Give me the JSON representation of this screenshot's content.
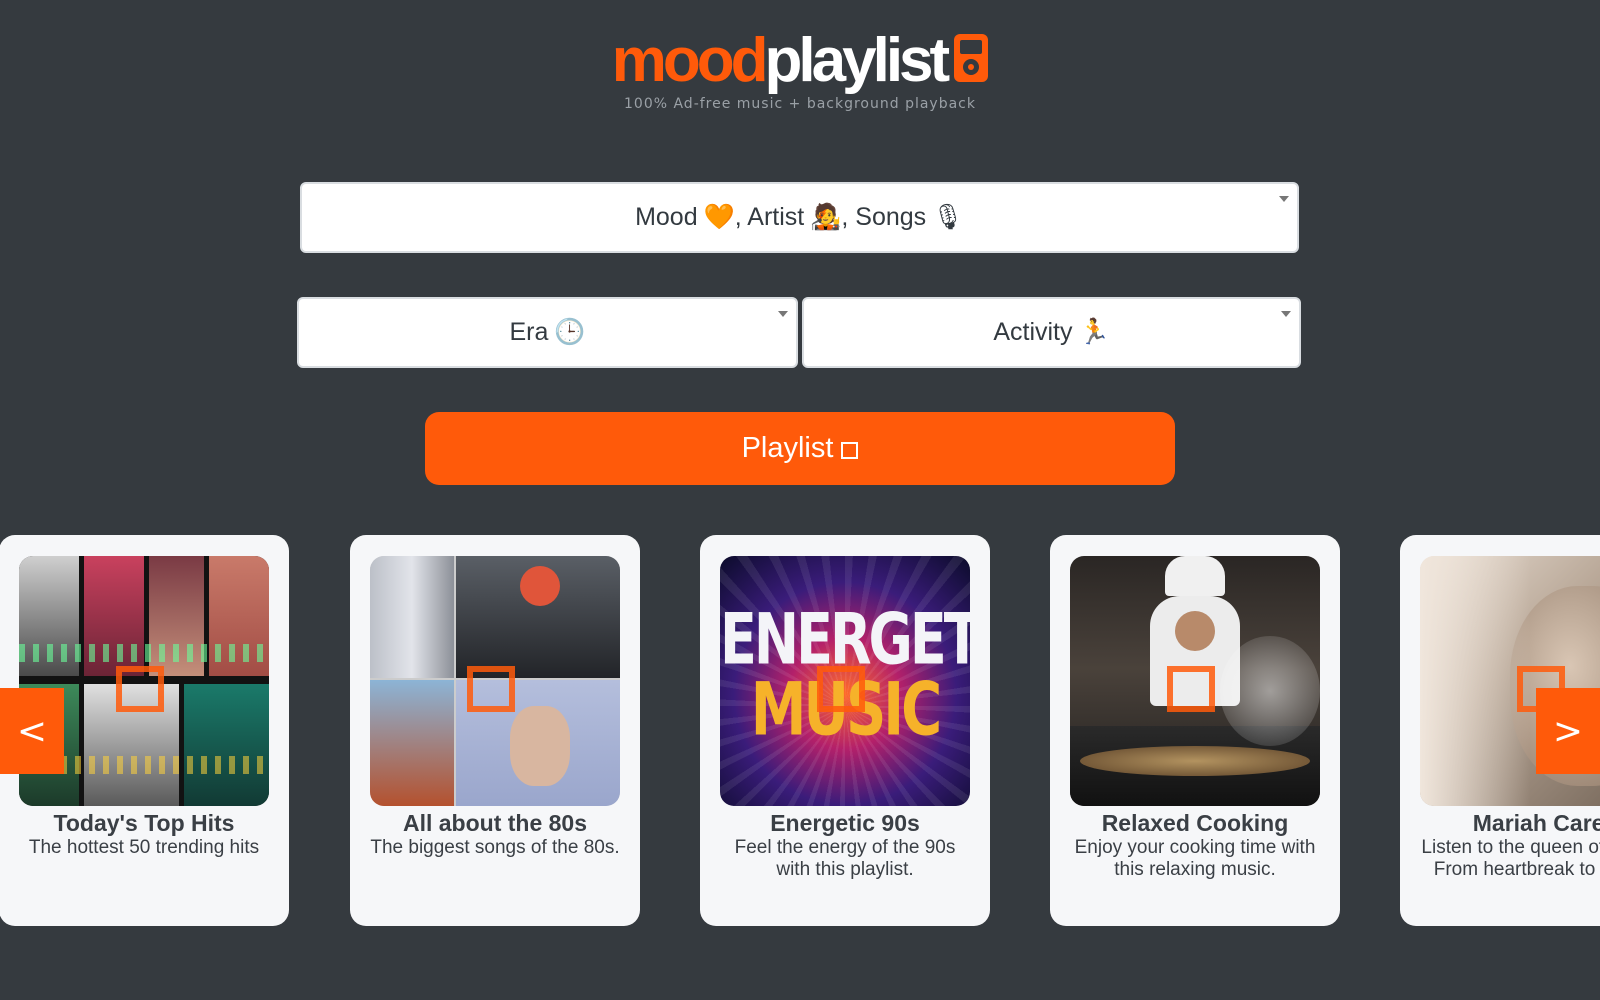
{
  "header": {
    "logo_mood": "mood",
    "logo_playlist": "playlist",
    "tagline": "100% Ad-free music + background playback"
  },
  "filters": {
    "main_label": "Mood",
    "main_emoji_1": "🧡",
    "main_artist": ", Artist",
    "main_emoji_2": "🧑‍🎤",
    "main_songs": ", Songs",
    "main_emoji_3": "🎙",
    "era_label": "Era",
    "era_emoji": "🕒",
    "activity_label": "Activity",
    "activity_emoji": "🏃"
  },
  "playlist_button": {
    "label": "Playlist"
  },
  "carousel": {
    "prev_label": "<",
    "next_label": ">",
    "cards": [
      {
        "title": "Today's Top Hits",
        "desc": "The hottest 50 trending hits"
      },
      {
        "title": "All about the 80s",
        "desc": "The biggest songs of the 80s."
      },
      {
        "title": "Energetic 90s",
        "desc": "Feel the energy of the 90s with this playlist.",
        "art_line1": "ENERGETIC",
        "art_line2": "MUSIC"
      },
      {
        "title": "Relaxed Cooking",
        "desc": "Enjoy your cooking time with this relaxing music."
      },
      {
        "title": "Mariah Carey",
        "desc": "Listen to the queen of vocals. From heartbreak to honey."
      }
    ]
  },
  "colors": {
    "background": "#353a3f",
    "accent": "#ff5a0a",
    "card": "#f6f7f9"
  }
}
